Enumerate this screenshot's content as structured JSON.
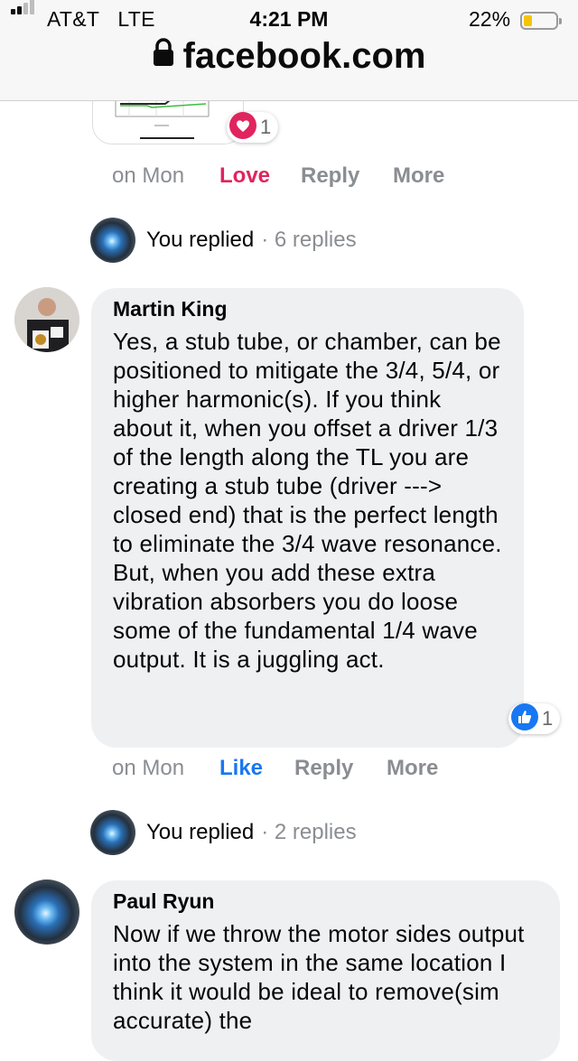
{
  "status_bar": {
    "carrier": "AT&T",
    "network": "LTE",
    "time": "4:21 PM",
    "battery_percent": "22%",
    "battery_level": 0.22,
    "signal_bars": 2
  },
  "url_bar": {
    "domain": "facebook.com",
    "icon": "lock-icon"
  },
  "comments": [
    {
      "reaction": {
        "icon": "love-reaction-icon",
        "count": "1"
      },
      "actions": {
        "time": "on Mon",
        "react": "Love",
        "reply": "Reply",
        "more": "More"
      },
      "replies_summary": {
        "label": "You replied",
        "count": "· 6 replies"
      }
    },
    {
      "author": "Martin King",
      "text": "Yes, a stub tube, or chamber, can be positioned to mitigate the 3/4, 5/4, or higher harmonic(s). If you think about it, when you offset a driver 1/3 of the length along the TL you are creating a stub tube (driver ---> closed end) that is the perfect length to eliminate the 3/4 wave resonance. But, when you add these extra vibration absorbers you do loose some of the fundamental 1/4 wave output. It is a juggling act.",
      "reaction": {
        "icon": "like-reaction-icon",
        "count": "1"
      },
      "actions": {
        "time": "on Mon",
        "react": "Like",
        "reply": "Reply",
        "more": "More"
      },
      "replies_summary": {
        "label": "You replied",
        "count": "· 2 replies"
      }
    },
    {
      "author": "Paul Ryun",
      "text": "Now if we throw the motor sides output into the system in the same location I think it would be ideal to remove(sim accurate) the"
    }
  ],
  "colors": {
    "love": "#e0245e",
    "like": "#1877f2",
    "muted": "#8a8d91",
    "bubble": "#eff0f2"
  }
}
